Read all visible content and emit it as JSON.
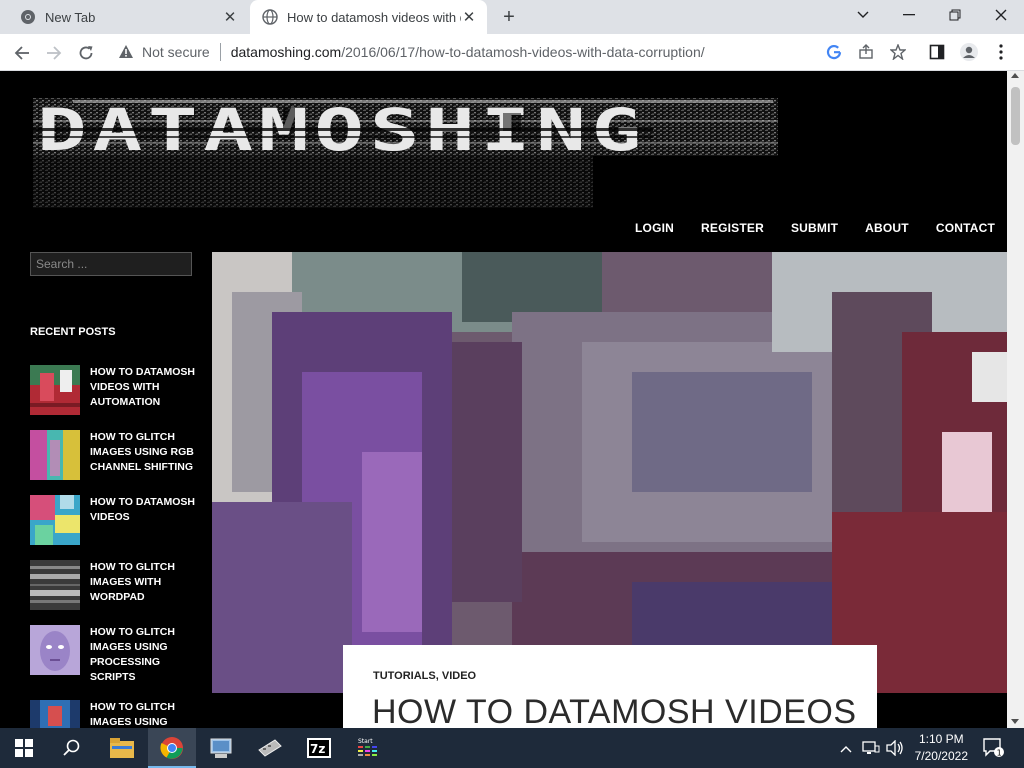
{
  "browser": {
    "tabs": [
      {
        "title": "New Tab",
        "active": false
      },
      {
        "title": "How to datamosh videos with da",
        "active": true
      }
    ],
    "url_security": "Not secure",
    "url_host": "datamoshing.com",
    "url_path": "/2016/06/17/how-to-datamosh-videos-with-data-corruption/"
  },
  "site": {
    "logo_text": "DATAMOSHING",
    "nav": [
      "LOGIN",
      "REGISTER",
      "SUBMIT",
      "ABOUT",
      "CONTACT"
    ],
    "search_placeholder": "Search ...",
    "recent_heading": "RECENT POSTS",
    "recent_posts": [
      {
        "title": "HOW TO DATAMOSH VIDEOS WITH AUTOMATION"
      },
      {
        "title": "HOW TO GLITCH IMAGES USING RGB CHANNEL SHIFTING"
      },
      {
        "title": "HOW TO DATAMOSH VIDEOS"
      },
      {
        "title": "HOW TO GLITCH IMAGES WITH WORDPAD"
      },
      {
        "title": "HOW TO GLITCH IMAGES USING PROCESSING SCRIPTS"
      },
      {
        "title": "HOW TO GLITCH IMAGES USING"
      }
    ],
    "article": {
      "category_1": "TUTORIALS",
      "category_sep": ", ",
      "category_2": "VIDEO",
      "headline": "HOW TO DATAMOSH VIDEOS"
    }
  },
  "taskbar": {
    "time": "1:10 PM",
    "date": "7/20/2022",
    "notification_count": "1",
    "start_label": "Start"
  }
}
